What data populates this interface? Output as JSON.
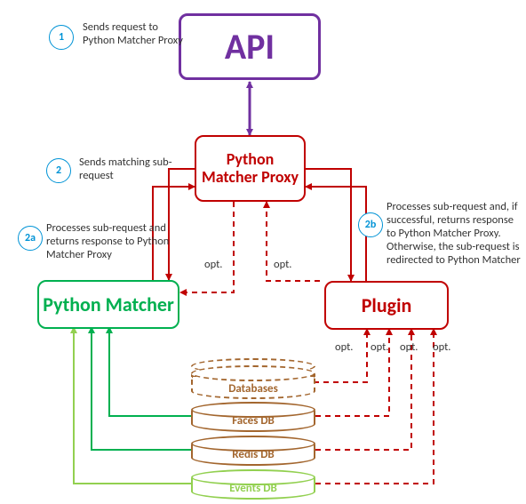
{
  "nodes": {
    "api": "API",
    "proxy": "Python Matcher Proxy",
    "python_matcher": "Python Matcher",
    "plugin": "Plugin"
  },
  "cylinders": {
    "databases": "Databases",
    "faces": "Faces DB",
    "redis": "Redis DB",
    "events": "Events DB"
  },
  "badges": [
    {
      "id": "1",
      "text": "Sends request to Python Matcher Proxy"
    },
    {
      "id": "2",
      "text": "Sends matching sub-request"
    },
    {
      "id": "2a",
      "text": "Processes sub-request and returns response to Python Matcher Proxy"
    },
    {
      "id": "2b",
      "text": "Processes sub-request and, if successful, returns response to Python Matcher Proxy. Otherwise, the sub-request is redirected to Python Matcher"
    }
  ],
  "labels": {
    "opt": "opt."
  },
  "colors": {
    "purple": "#7030a0",
    "red": "#c00000",
    "green": "#00b050",
    "light_green": "#92d050",
    "brown": "#a3662e",
    "badge_blue": "#0093d6"
  }
}
